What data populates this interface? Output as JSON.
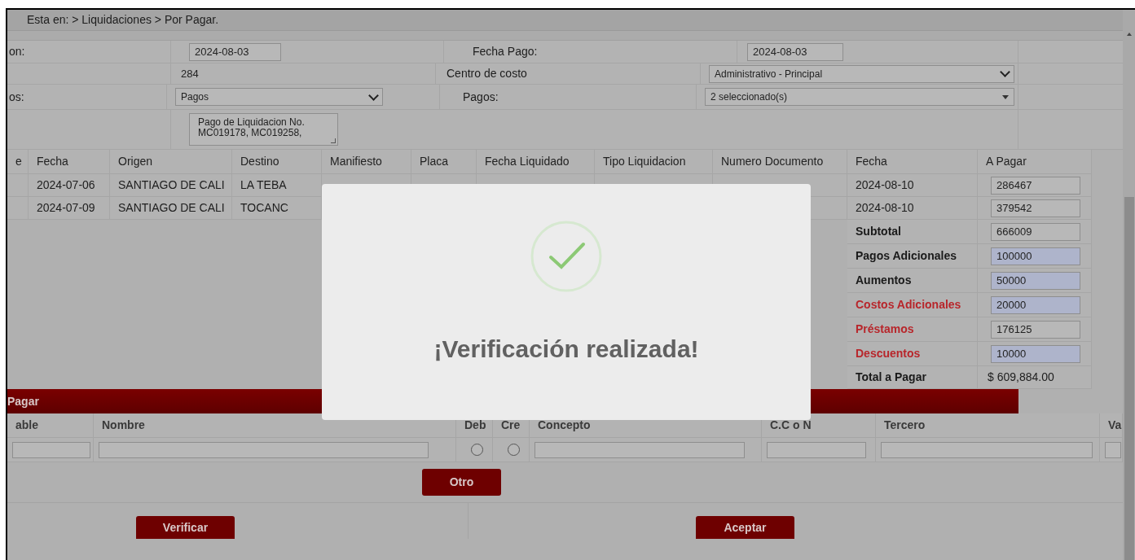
{
  "breadcrumb": "Esta en: > Liquidaciones > Por Pagar.",
  "form": {
    "row1": {
      "label": "on:",
      "value": "2024-08-03",
      "label2": "Fecha Pago:",
      "value2": "2024-08-03"
    },
    "row2": {
      "value": "284",
      "label2": "Centro de costo",
      "select2": "Administrativo - Principal"
    },
    "row3": {
      "label": "os:",
      "select": "Pagos",
      "label2": "Pagos:",
      "multiselect": "2 seleccionado(s)"
    },
    "row4": {
      "textarea": "Pago de Liquidacion No. MC019178, MC019258,"
    }
  },
  "table": {
    "columns": [
      "e",
      "Fecha",
      "Origen",
      "Destino",
      "Manifiesto",
      "Placa",
      "Fecha Liquidado",
      "Tipo Liquidacion",
      "Numero Documento",
      "Fecha",
      "A Pagar"
    ],
    "rows": [
      {
        "fecha": "2024-07-06",
        "origen": "SANTIAGO DE CALI",
        "destino": "LA TEBA",
        "fecha_pago": "2024-08-10",
        "a_pagar": "286467"
      },
      {
        "fecha": "2024-07-09",
        "origen": "SANTIAGO DE CALI",
        "destino": "TOCANC",
        "fecha_pago": "2024-08-10",
        "a_pagar": "379542"
      }
    ]
  },
  "summary": [
    {
      "kind": "input",
      "label": "Subtotal",
      "value": "666009",
      "color": "#1a1a1a",
      "highlighted": false
    },
    {
      "kind": "input",
      "label": "Pagos Adicionales",
      "value": "100000",
      "color": "#1a1a1a",
      "highlighted": true
    },
    {
      "kind": "input",
      "label": "Aumentos",
      "value": "50000",
      "color": "#1a1a1a",
      "highlighted": true
    },
    {
      "kind": "input",
      "label": "Costos Adicionales",
      "value": "20000",
      "color": "#b8262b",
      "highlighted": true
    },
    {
      "kind": "input",
      "label": "Préstamos",
      "value": "176125",
      "color": "#b8262b",
      "highlighted": false
    },
    {
      "kind": "input",
      "label": "Descuentos",
      "value": "10000",
      "color": "#b8262b",
      "highlighted": true
    },
    {
      "kind": "text",
      "label": "Total a Pagar",
      "value": "$ 609,884.00",
      "color": "#1a1a1a"
    }
  ],
  "section_bar": {
    "title": "Pagar"
  },
  "entry_grid": {
    "columns": [
      {
        "kind": "text",
        "label": "able"
      },
      {
        "kind": "text",
        "label": "Nombre"
      },
      {
        "kind": "radio",
        "label": "Deb",
        "checked": false
      },
      {
        "kind": "radio",
        "label": "Cre",
        "checked": false
      },
      {
        "kind": "text",
        "label": "Concepto"
      },
      {
        "kind": "text",
        "label": "C.C o N"
      },
      {
        "kind": "text",
        "label": "Tercero"
      },
      {
        "kind": "text",
        "label": "Va"
      }
    ]
  },
  "add_button": "Otro",
  "actions": [
    "Verificar",
    "Aceptar"
  ],
  "dialog": {
    "title": "¡Verificación realizada!"
  }
}
